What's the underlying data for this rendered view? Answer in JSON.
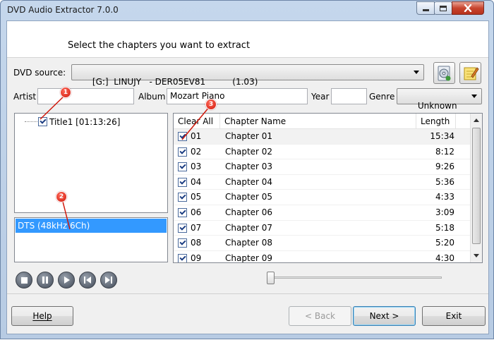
{
  "window": {
    "title": "DVD Audio Extractor 7.0.0"
  },
  "header": {
    "text": "Select the chapters you want to extract"
  },
  "source": {
    "label": "DVD source:",
    "value": "[G:]  LINUJY   - DER05EV81          (1.03)"
  },
  "meta": {
    "artist_label": "Artist",
    "artist_value": "",
    "album_label": "Album",
    "album_value": "Mozart Piano",
    "year_label": "Year",
    "year_value": "",
    "genre_label": "Genre",
    "genre_value": "Unknown"
  },
  "tree": {
    "title_item": "Title1 [01:13:26]"
  },
  "audio_streams": [
    "DTS (48kHz 6Ch)"
  ],
  "chapters": {
    "headers": {
      "select": "Clear All",
      "name": "Chapter Name",
      "length": "Length"
    },
    "rows": [
      {
        "num": "01",
        "name": "Chapter 01",
        "length": "15:34"
      },
      {
        "num": "02",
        "name": "Chapter 02",
        "length": "8:12"
      },
      {
        "num": "03",
        "name": "Chapter 03",
        "length": "9:26"
      },
      {
        "num": "04",
        "name": "Chapter 04",
        "length": "5:36"
      },
      {
        "num": "05",
        "name": "Chapter 05",
        "length": "4:33"
      },
      {
        "num": "06",
        "name": "Chapter 06",
        "length": "3:09"
      },
      {
        "num": "07",
        "name": "Chapter 07",
        "length": "5:18"
      },
      {
        "num": "08",
        "name": "Chapter 08",
        "length": "5:20"
      },
      {
        "num": "09",
        "name": "Chapter 09",
        "length": "4:30"
      }
    ]
  },
  "playback": {
    "position": 0.0
  },
  "buttons": {
    "help": "Help",
    "back": "< Back",
    "next": "Next >",
    "exit": "Exit"
  },
  "annotations": [
    "1",
    "2",
    "3"
  ],
  "colors": {
    "annotation": "#d0170a",
    "selection": "#3399ff"
  }
}
